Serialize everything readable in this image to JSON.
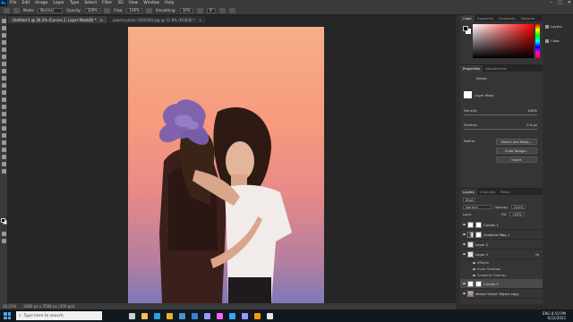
{
  "app": {
    "logo": "Ps"
  },
  "menu": [
    "File",
    "Edit",
    "Image",
    "Layer",
    "Type",
    "Select",
    "Filter",
    "3D",
    "View",
    "Window",
    "Help"
  ],
  "window_controls": [
    "–",
    "□",
    "✕"
  ],
  "options_bar": {
    "mode_label": "Mode:",
    "mode_value": "Normal",
    "opacity_label": "Opacity:",
    "opacity_value": "100%",
    "flow_label": "Flow:",
    "flow_value": "100%",
    "smoothing_label": "Smoothing:",
    "smoothing_value": "10%",
    "angle_value": "0°"
  },
  "tabs": [
    {
      "label": "Untitled-1 @ 26.2% (Curves 2, Layer Mask/8) *",
      "active": true
    },
    {
      "label": "pexels-photo-1000390.jpg @ 11.8% (RGB/8) *",
      "active": false
    }
  ],
  "status": {
    "zoom": "26.21%",
    "doc": "2480 px x 3508 px (300 ppi)"
  },
  "color_panel": {
    "tabs": [
      "Color",
      "Swatches",
      "Gradients",
      "Patterns"
    ]
  },
  "properties": {
    "tabs": [
      "Properties",
      "Adjustments"
    ],
    "section": "Masks",
    "mask_label": "Layer Mask",
    "density_label": "Density:",
    "density_value": "100%",
    "feather_label": "Feather:",
    "feather_value": "0.0 px",
    "refine_label": "Refine:",
    "buttons": [
      "Select and Mask...",
      "Color Range...",
      "Invert"
    ]
  },
  "layers_panel": {
    "tabs": [
      "Layers",
      "Channels",
      "Paths"
    ],
    "kind_label": "Kind",
    "blend_value": "Normal",
    "opacity_label": "Opacity:",
    "opacity_value": "100%",
    "fill_label": "Fill:",
    "fill_value": "100%",
    "lock_label": "Lock:",
    "layers": [
      {
        "name": "Curves 1",
        "thumb": "white",
        "selected": false
      },
      {
        "name": "Gradient Map 1",
        "thumb": "grad",
        "selected": false
      },
      {
        "name": "Layer 2",
        "thumb": "checker",
        "selected": false
      },
      {
        "name": "Layer 1",
        "thumb": "checker",
        "selected": false
      },
      {
        "name": "Curves 2",
        "thumb": "white",
        "selected": true
      },
      {
        "name": "Vector Smart Object copy",
        "thumb": "photo",
        "selected": false
      }
    ],
    "effects": [
      "Effects",
      "Inner Shadow",
      "Gradient Overlay"
    ]
  },
  "mini_panel": {
    "items": [
      "Layers",
      "Color"
    ]
  },
  "taskbar": {
    "search_placeholder": "Type here to search",
    "time": "8:50 PM",
    "date": "6/22/2022",
    "lang": "ENG",
    "app_icons": [
      {
        "name": "task-view-icon",
        "color": "#cfcfcf"
      },
      {
        "name": "file-explorer-icon",
        "color": "#f2c14e"
      },
      {
        "name": "edge-icon",
        "color": "#2f9fe0"
      },
      {
        "name": "chrome-icon",
        "color": "#e8b22b"
      },
      {
        "name": "store-icon",
        "color": "#4a90d9"
      },
      {
        "name": "mail-icon",
        "color": "#3d7fd0"
      },
      {
        "name": "premiere-icon",
        "color": "#9999ff"
      },
      {
        "name": "xd-icon",
        "color": "#ff61f6"
      },
      {
        "name": "photoshop-icon",
        "color": "#31a8ff"
      },
      {
        "name": "after-effects-icon",
        "color": "#9999ff"
      },
      {
        "name": "illustrator-icon",
        "color": "#ff9a00"
      },
      {
        "name": "bridge-icon",
        "color": "#e8e8e8"
      }
    ]
  }
}
